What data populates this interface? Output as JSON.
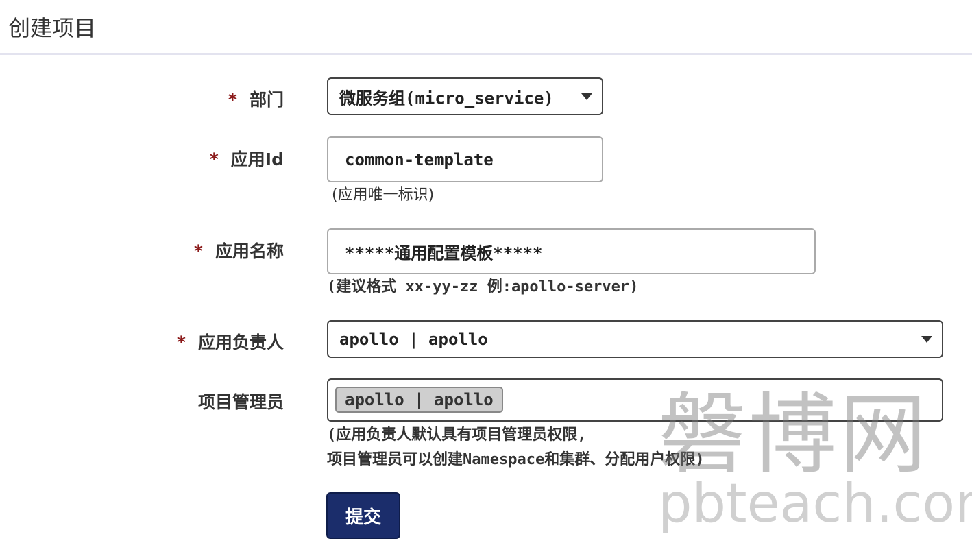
{
  "header": {
    "title": "创建项目"
  },
  "form": {
    "required_mark": "*",
    "department": {
      "label": "部门",
      "value": "微服务组(micro_service)"
    },
    "app_id": {
      "label": "应用Id",
      "value": "common-template",
      "hint": "(应用唯一标识)"
    },
    "app_name": {
      "label": "应用名称",
      "value": "*****通用配置模板*****",
      "hint": "(建议格式 xx-yy-zz 例:apollo-server)"
    },
    "owner": {
      "label": "应用负责人",
      "value": "apollo | apollo"
    },
    "admins": {
      "label": "项目管理员",
      "tags": [
        "apollo | apollo"
      ],
      "hint_line1": "(应用负责人默认具有项目管理员权限,",
      "hint_line2": "项目管理员可以创建Namespace和集群、分配用户权限)"
    },
    "submit_label": "提交"
  },
  "watermark": {
    "cn": "磐博网",
    "en": "pbteach.com"
  },
  "colors": {
    "required": "#8b1a1a",
    "submit_bg": "#1b2d6b",
    "tag_bg": "#cfcfcf"
  }
}
